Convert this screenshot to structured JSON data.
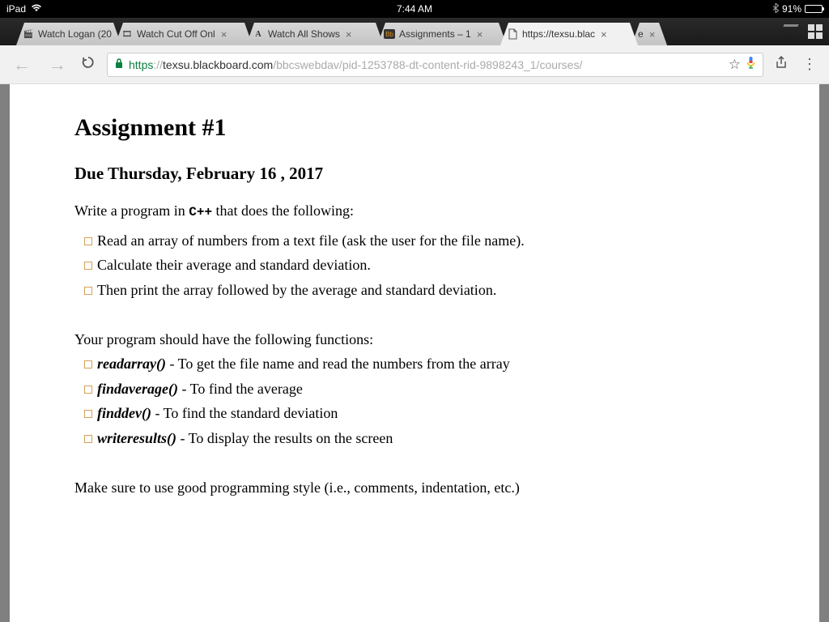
{
  "ios_status": {
    "device": "iPad",
    "time": "7:44 AM",
    "battery_pct": "91%"
  },
  "tabs": [
    {
      "title": "Watch Logan (20"
    },
    {
      "title": "Watch Cut Off Onl"
    },
    {
      "title": "Watch All Shows"
    },
    {
      "title": "Assignments – 1"
    },
    {
      "title": "https://texsu.blac"
    },
    {
      "title": "e"
    }
  ],
  "omnibox": {
    "scheme": "https",
    "sep": "://",
    "host": "texsu.blackboard.com",
    "path": "/bbcswebdav/pid-1253788-dt-content-rid-9898243_1/courses/"
  },
  "doc": {
    "title": "Assignment #1",
    "due": "Due Thursday, February 16 , 2017",
    "intro_prefix": "Write a program in ",
    "intro_lang": "C++",
    "intro_suffix": " that does the following:",
    "reqs": [
      "Read an array of numbers from a text file (ask the user for the file name).",
      "Calculate their average and standard deviation.",
      "Then print the array followed by the average and standard deviation."
    ],
    "funcs_intro": "Your program should have the following functions:",
    "funcs": [
      {
        "name": "readarray()",
        "desc": " - To get the file name and read the numbers from the array"
      },
      {
        "name": "findaverage()",
        "desc": " - To find the average"
      },
      {
        "name": "finddev()",
        "desc": " - To find the standard deviation"
      },
      {
        "name": "writeresults()",
        "desc": " - To display the results on the screen"
      }
    ],
    "closing": "Make sure to use good programming style (i.e., comments, indentation, etc.)"
  }
}
